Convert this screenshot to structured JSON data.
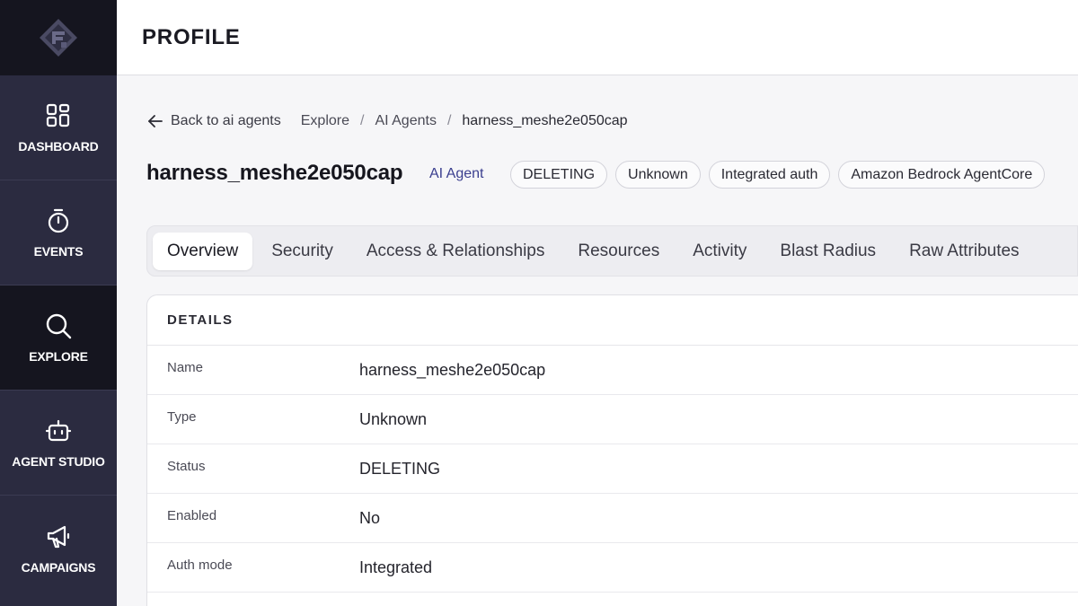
{
  "sidebar": {
    "logo": "logo-icon",
    "items": [
      {
        "label": "DASHBOARD",
        "icon": "grid-icon",
        "active": false
      },
      {
        "label": "EVENTS",
        "icon": "stopwatch-icon",
        "active": false
      },
      {
        "label": "EXPLORE",
        "icon": "search-icon",
        "active": true
      },
      {
        "label": "AGENT STUDIO",
        "icon": "robot-icon",
        "active": false
      },
      {
        "label": "CAMPAIGNS",
        "icon": "megaphone-icon",
        "active": false
      }
    ]
  },
  "header": {
    "title": "PROFILE"
  },
  "breadcrumb": {
    "back_label": "Back to ai agents",
    "items": [
      "Explore",
      "AI Agents"
    ],
    "current": "harness_meshe2e050cap"
  },
  "entity": {
    "name": "harness_meshe2e050cap",
    "type": "AI Agent",
    "tags": [
      "DELETING",
      "Unknown",
      "Integrated auth",
      "Amazon Bedrock AgentCore"
    ]
  },
  "tabs": [
    "Overview",
    "Security",
    "Access & Relationships",
    "Resources",
    "Activity",
    "Blast Radius",
    "Raw Attributes"
  ],
  "active_tab": "Overview",
  "details": {
    "title": "DETAILS",
    "rows": [
      {
        "key": "Name",
        "value": "harness_meshe2e050cap"
      },
      {
        "key": "Type",
        "value": "Unknown"
      },
      {
        "key": "Status",
        "value": "DELETING"
      },
      {
        "key": "Enabled",
        "value": "No"
      },
      {
        "key": "Auth mode",
        "value": "Integrated"
      }
    ]
  },
  "colors": {
    "sidebar": "#2b2b40",
    "sidebar_active": "#15151f",
    "accent": "#3b3f8f"
  }
}
